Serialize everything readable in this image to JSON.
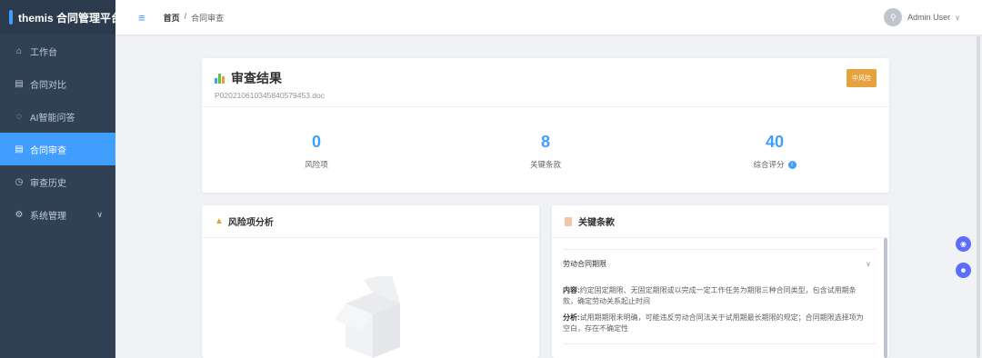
{
  "app": {
    "title": "themis 合同管理平台"
  },
  "sidebar": {
    "items": [
      {
        "label": "工作台",
        "icon": "home-icon"
      },
      {
        "label": "合同对比",
        "icon": "document-icon"
      },
      {
        "label": "AI智能问答",
        "icon": "chat-icon"
      },
      {
        "label": "合同审查",
        "icon": "document-icon",
        "active": true
      },
      {
        "label": "审查历史",
        "icon": "clock-icon"
      },
      {
        "label": "系统管理",
        "icon": "gear-icon",
        "has_submenu": true
      }
    ]
  },
  "header": {
    "breadcrumb": [
      "首页",
      "/",
      "合同审查"
    ],
    "user_name": "Admin User"
  },
  "result": {
    "title": "审查结果",
    "file_name": "P020210610345840579453.doc",
    "risk_badge": "中风险",
    "stats": [
      {
        "value": "0",
        "label": "风险项"
      },
      {
        "value": "8",
        "label": "关键条款"
      },
      {
        "value": "40",
        "label": "综合评分"
      }
    ]
  },
  "risk_panel": {
    "title": "风险项分析"
  },
  "key_panel": {
    "title": "关键条款",
    "clause": {
      "name": "劳动合同期限",
      "content_label": "内容:",
      "content": "约定固定期限、无固定期限或以完成一定工作任务为期限三种合同类型，包含试用期条款，确定劳动关系起止时间",
      "analysis_label": "分析:",
      "analysis": "试用期期限未明确，可能违反劳动合同法关于试用期最长期限的规定；合同期限选择项为空白，存在不确定性"
    }
  },
  "colors": {
    "accent": "#409eff",
    "sidebar": "#304156",
    "warning": "#e6a23c"
  }
}
